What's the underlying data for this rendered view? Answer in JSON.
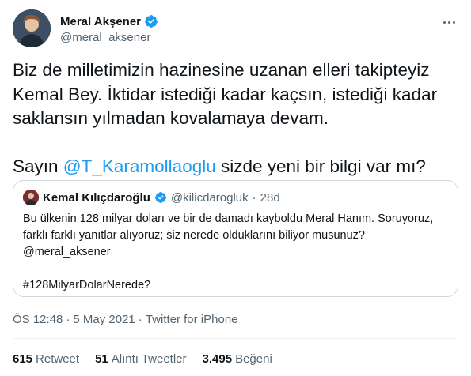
{
  "author": {
    "name": "Meral Akşener",
    "handle": "@meral_aksener"
  },
  "tweet": {
    "line1": "Biz de milletimizin hazinesine uzanan elleri takipteyiz",
    "line2": "Kemal Bey. İktidar istediği kadar kaçsın, istediği kadar",
    "line3": "saklansın yılmadan kovalamaya devam.",
    "line4_pre": "Sayın ",
    "line4_mention": "@T_Karamollaoglu",
    "line4_post": " sizde yeni bir bilgi var mı?"
  },
  "quote": {
    "name": "Kemal Kılıçdaroğlu",
    "handle": "@kilicdarogluk",
    "dot": "·",
    "time": "28d",
    "line1": "Bu ülkenin 128 milyar doları ve bir de damadı kayboldu Meral Hanım. Soruyoruz,",
    "line2": "farklı farklı yanıtlar alıyoruz; siz nerede olduklarını biliyor musunuz?",
    "line3": "@meral_aksener",
    "line4": "#128MilyarDolarNerede?"
  },
  "meta": {
    "time": "ÖS 12:48",
    "sep1": "·",
    "date": "5 May 2021",
    "sep2": "·",
    "source": "Twitter for iPhone"
  },
  "stats": {
    "retweets_count": "615",
    "retweets_label": "Retweet",
    "quotes_count": "51",
    "quotes_label": "Alıntı Tweetler",
    "likes_count": "3.495",
    "likes_label": "Beğeni"
  },
  "colors": {
    "accent": "#1d9bf0",
    "muted": "#536471",
    "text": "#0f1419",
    "border": "#cfd9de"
  }
}
